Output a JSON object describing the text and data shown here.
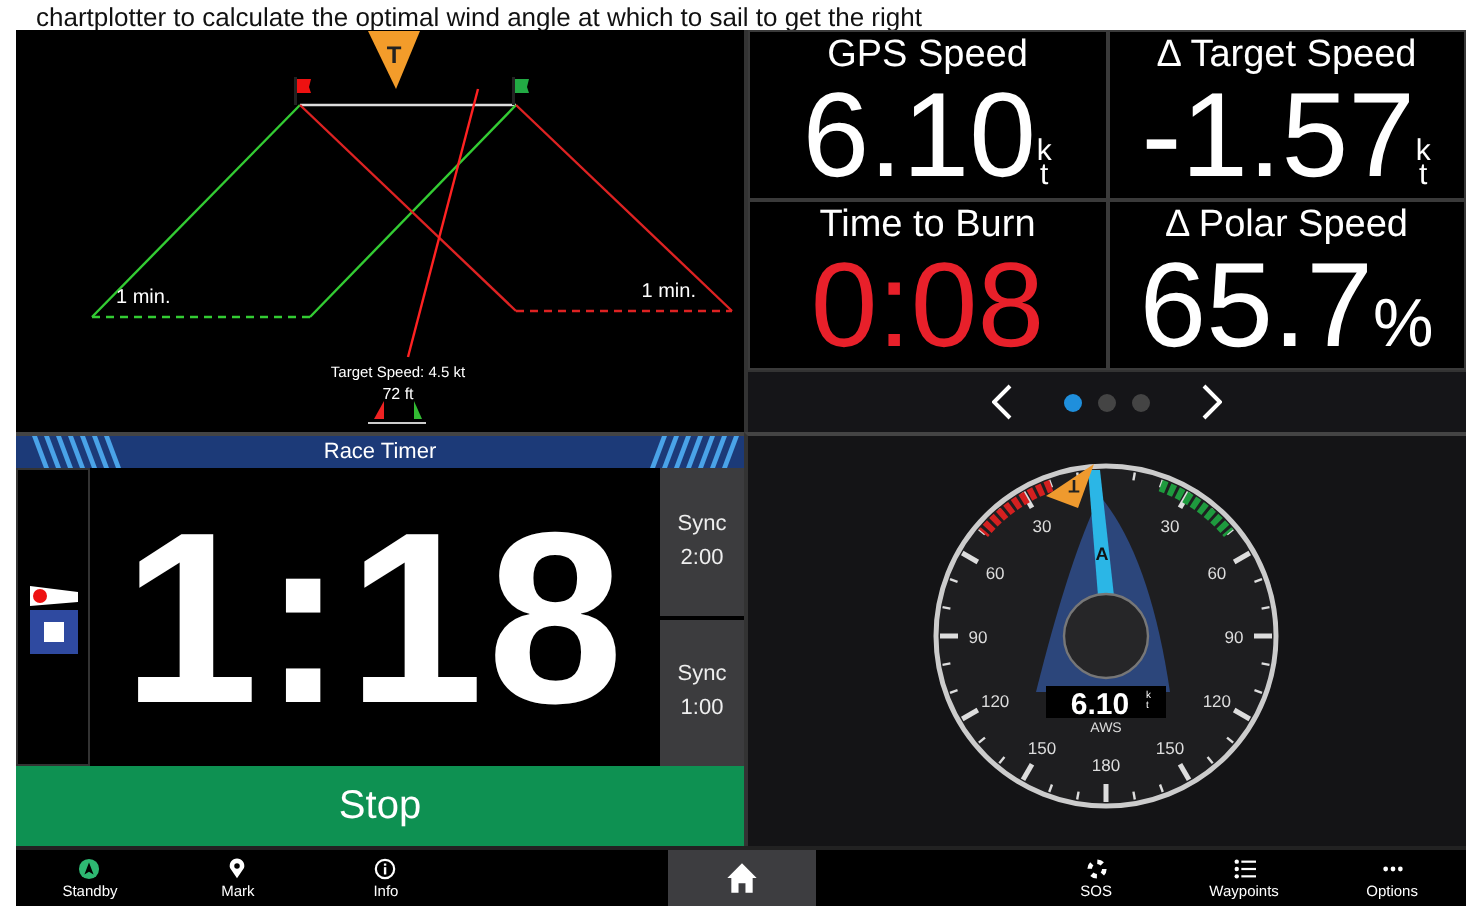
{
  "caption": "chartplotter to calculate the optimal wind angle at which to sail to get the right",
  "start_line": {
    "marker": "T",
    "left_label": "1 min.",
    "right_label": "1 min.",
    "target_speed": "Target Speed: 4.5 kt",
    "distance": "72 ft"
  },
  "data_tiles": [
    {
      "title": "GPS Speed",
      "value": "6.10",
      "unit": "kt",
      "alert": false
    },
    {
      "title": "Δ Target Speed",
      "value": "-1.57",
      "unit": "kt",
      "alert": false
    },
    {
      "title": "Time to Burn",
      "value": "0:08",
      "alert": true
    },
    {
      "title": "Δ Polar Speed",
      "value": "65.7",
      "unit": "%",
      "alert": false
    }
  ],
  "pager": [
    {
      "selected": true
    },
    {
      "selected": false
    },
    {
      "selected": false
    }
  ],
  "race_timer": {
    "title": "Race Timer",
    "time": "1:18",
    "sync_buttons": [
      {
        "label": "Sync",
        "time": "2:00"
      },
      {
        "label": "Sync",
        "time": "1:00"
      }
    ],
    "stop": "Stop"
  },
  "wind_gauge": {
    "scale_labels": [
      "30",
      "30",
      "60",
      "60",
      "90",
      "90",
      "120",
      "120",
      "150",
      "150",
      "180"
    ],
    "target_marker": "T",
    "apparent_marker": "A",
    "reading": "6.10",
    "unit": "kt",
    "label": "AWS"
  },
  "nav": [
    {
      "kind": "standby",
      "label": "Standby",
      "selected": false
    },
    {
      "kind": "mark",
      "label": "Mark",
      "selected": false
    },
    {
      "kind": "info",
      "label": "Info",
      "selected": false
    },
    {
      "kind": "home",
      "selected": true
    },
    {
      "kind": "sos",
      "label": "SOS",
      "selected": false
    },
    {
      "kind": "waypoints",
      "label": "Waypoints",
      "selected": false
    },
    {
      "kind": "options",
      "label": "Options",
      "selected": false
    }
  ]
}
